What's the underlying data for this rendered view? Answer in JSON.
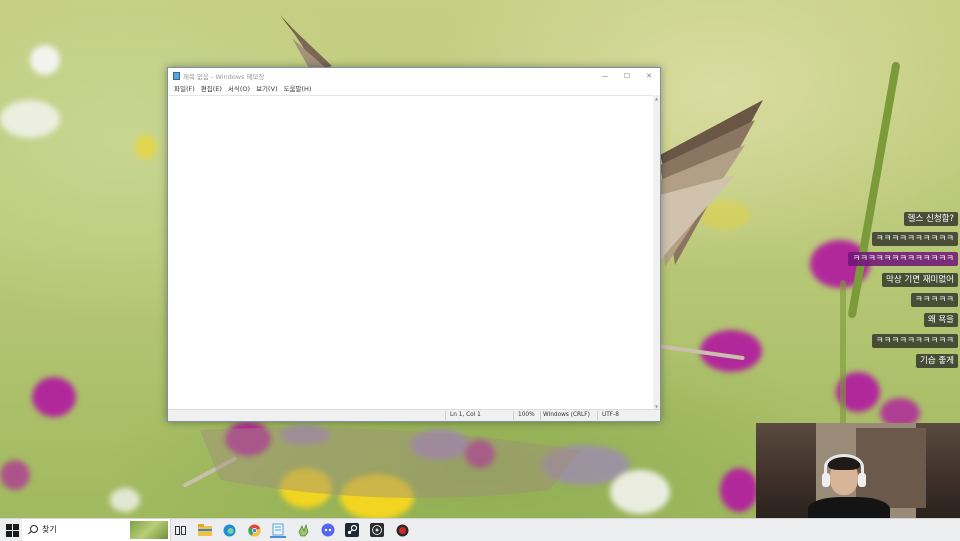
{
  "notepad": {
    "title": "제목 없음 - Windows 메모장",
    "controls": {
      "minimize": "—",
      "maximize": "☐",
      "close": "✕"
    },
    "menus": [
      "파일(F)",
      "편집(E)",
      "서식(O)",
      "보기(V)",
      "도움말(H)"
    ],
    "content": "",
    "status": {
      "position": "Ln 1, Col 1",
      "zoom": "100%",
      "line_ending": "Windows (CRLF)",
      "encoding": "UTF-8"
    }
  },
  "chat": [
    {
      "text": "헬스 신청함?",
      "highlight": false
    },
    {
      "text": "ㅋㅋㅋㅋㅋㅋㅋㅋㅋㅋ",
      "highlight": false
    },
    {
      "text": "ㅋㅋㅋㅋㅋㅋㅋㅋㅋㅋㅋㅋㅋ",
      "highlight": true
    },
    {
      "text": "막상 기면 재미없어",
      "highlight": false
    },
    {
      "text": "ㅋㅋㅋㅋㅋ",
      "highlight": false
    },
    {
      "text": "왜 욕을",
      "highlight": false
    },
    {
      "text": "ㅋㅋㅋㅋㅋㅋㅋㅋㅋㅋ",
      "highlight": false
    },
    {
      "text": "기습 좋게",
      "highlight": false
    }
  ],
  "taskbar": {
    "search_label": "찾기",
    "icons": [
      {
        "name": "task-view-icon",
        "color": "#333333"
      },
      {
        "name": "file-explorer-icon",
        "color": "#f2c14a"
      },
      {
        "name": "edge-icon",
        "color": "#1f8fcf"
      },
      {
        "name": "chrome-icon",
        "color": "#e0483a"
      },
      {
        "name": "notepad-icon",
        "color": "#5aa5d8"
      },
      {
        "name": "hand-tool-icon",
        "color": "#4a8a3c"
      },
      {
        "name": "discord-icon",
        "color": "#5865f2"
      },
      {
        "name": "steam-icon",
        "color": "#1b2838"
      },
      {
        "name": "obs-icon",
        "color": "#2b2b2b"
      },
      {
        "name": "record-icon",
        "color": "#d32626"
      }
    ]
  }
}
